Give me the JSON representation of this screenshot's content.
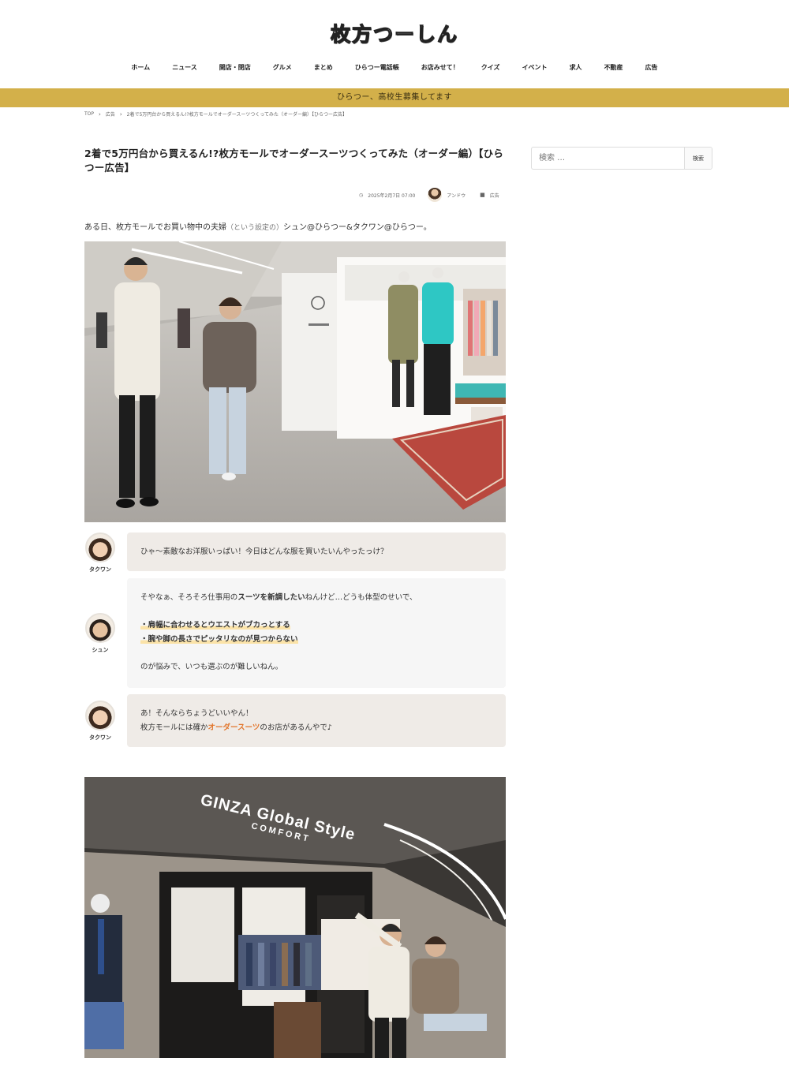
{
  "site": {
    "logo": "枚方つーしん"
  },
  "nav": [
    "ホーム",
    "ニュース",
    "開店・閉店",
    "グルメ",
    "まとめ",
    "ひらつー電話帳",
    "お店みせて！",
    "クイズ",
    "イベント",
    "求人",
    "不動産",
    "広告"
  ],
  "notice": "ひらつー、高校生募集してます",
  "breadcrumb": [
    "TOP",
    "広告",
    "2着で5万円台から買えるん!?枚方モールでオーダースーツつくってみた（オーダー編）【ひらつー広告】"
  ],
  "article": {
    "title": "2着で5万円台から買えるん!?枚方モールでオーダースーツつくってみた（オーダー編）【ひらつー広告】",
    "date": "2025年2月7日 07:00",
    "author": "アンドウ",
    "category": "広告",
    "lead_main": "ある日、枚方モールでお買い物中の夫婦",
    "lead_sub": "（という設定の）",
    "lead_end": "シュン@ひらつー&タクワン@ひらつー。"
  },
  "chat": [
    {
      "name": "タクワン",
      "text": "ひゃ〜素敵なお洋服いっぱい！今日はどんな服を買いたいんやったっけ？"
    },
    {
      "name": "シュン",
      "line1_pre": "そやなぁ、そろそろ仕事用の",
      "line1_bold": "スーツを新調したい",
      "line1_post": "ねんけど…どうも体型のせいで、",
      "bullet1": "・肩幅に合わせるとウエストがブカっとする",
      "bullet2": "・腕や脚の長さでピッタリなのが見つからない",
      "line_end": "のが悩みで、いつも選ぶのが難しいねん。"
    },
    {
      "name": "タクワン",
      "line1": "あ！そんならちょうどいいやん！",
      "line2_pre": "枚方モールには確か",
      "line2_orange": "オーダースーツ",
      "line2_post": "のお店があるんやで♪"
    }
  ],
  "photo2_sign": {
    "line1": "GINZA Global Style",
    "line2": "COMFORT"
  },
  "sidebar": {
    "search_placeholder": "検索 …",
    "search_button": "検索"
  }
}
